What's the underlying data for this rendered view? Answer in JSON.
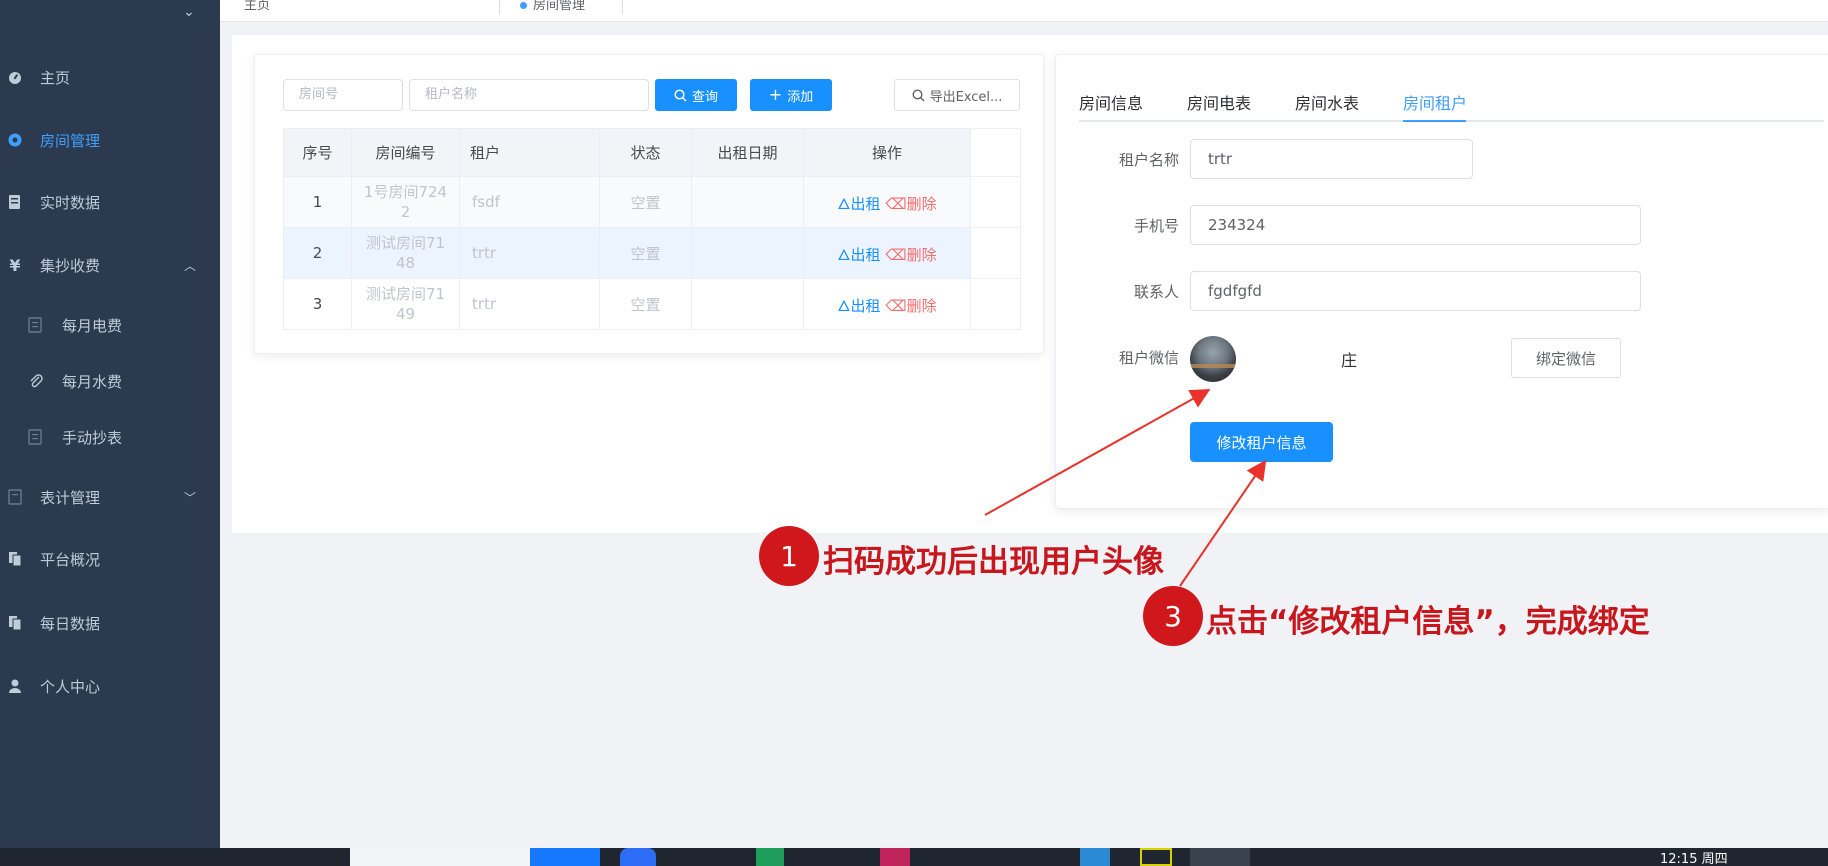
{
  "sidebar": {
    "items": [
      {
        "label": "主页"
      },
      {
        "label": "房间管理"
      },
      {
        "label": "实时数据"
      },
      {
        "label": "集抄收费"
      },
      {
        "label": "每月电费"
      },
      {
        "label": "每月水费"
      },
      {
        "label": "手动抄表"
      },
      {
        "label": "表计管理"
      },
      {
        "label": "平台概况"
      },
      {
        "label": "每日数据"
      },
      {
        "label": "个人中心"
      }
    ]
  },
  "breadcrumb": {
    "home": "主页",
    "current": "房间管理"
  },
  "search": {
    "room_placeholder": "房间号",
    "tenant_placeholder": "租户名称",
    "query_label": "查询",
    "add_label": "添加",
    "export_label": "导出Excel..."
  },
  "table": {
    "columns": [
      "序号",
      "房间编号",
      "租户",
      "状态",
      "出租日期",
      "操作"
    ],
    "rows": [
      {
        "idx": "1",
        "room_a": "1号房间724",
        "room_b": "2",
        "tenant": "fsdf",
        "status": "空置",
        "date": "",
        "rent": "出租",
        "del": "删除"
      },
      {
        "idx": "2",
        "room_a": "测试房间71",
        "room_b": "48",
        "tenant": "trtr",
        "status": "空置",
        "date": "",
        "rent": "出租",
        "del": "删除"
      },
      {
        "idx": "3",
        "room_a": "测试房间71",
        "room_b": "49",
        "tenant": "trtr",
        "status": "空置",
        "date": "",
        "rent": "出租",
        "del": "删除"
      }
    ]
  },
  "tabs": [
    "房间信息",
    "房间电表",
    "房间水表",
    "房间租户"
  ],
  "form": {
    "tenant_name_label": "租户名称",
    "tenant_name_value": "trtr",
    "phone_label": "手机号",
    "phone_value": "234324",
    "contact_label": "联系人",
    "contact_value": "fgdfgfd",
    "wechat_label": "租户微信",
    "wechat_name": "庄",
    "bind_button": "绑定微信",
    "submit_button": "修改租户信息"
  },
  "annotations": {
    "step1_num": "1",
    "step1_text": "扫码成功后出现用户头像",
    "step3_num": "3",
    "step3_text": "点击“修改租户信息”，完成绑定"
  },
  "taskbar": {
    "clock": "12:15 周四"
  },
  "colors": {
    "accent": "#409eff",
    "sidebar": "#2b3a4e",
    "annotation": "#d0171c",
    "danger": "#f56c6c"
  }
}
